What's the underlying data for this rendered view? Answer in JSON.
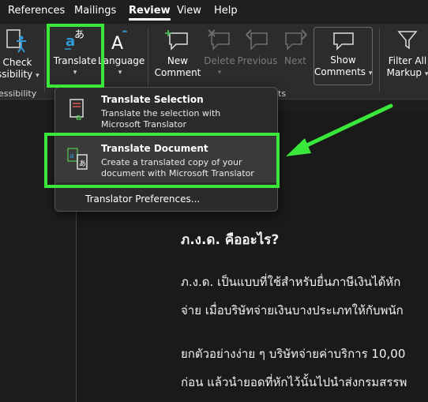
{
  "tabs": [
    "References",
    "Mailings",
    "Review",
    "View",
    "Help"
  ],
  "ribbon": {
    "check_accessibility": {
      "line1": "Check",
      "line2": "ssibility"
    },
    "accessibility_group": "essibility",
    "translate": "Translate",
    "language": "Language",
    "new_comment": {
      "line1": "New",
      "line2": "Comment"
    },
    "delete": "Delete",
    "previous": "Previous",
    "next": "Next",
    "show_comments": {
      "line1": "Show",
      "line2": "Comments"
    },
    "filter_all": {
      "line1": "Filter All",
      "line2": "Markup"
    },
    "comments_group_tail": "ts"
  },
  "menu": {
    "translate_selection": {
      "title": "Translate Selection",
      "desc1": "Translate the selection with",
      "desc2": "Microsoft Translator"
    },
    "translate_document": {
      "title": "Translate Document",
      "desc1": "Create a translated copy of your",
      "desc2": "document with Microsoft Translator"
    },
    "preferences": "Translator Preferences..."
  },
  "document": {
    "heading": "ภ.ง.ด. คืออะไร?",
    "para1_line1": "ภ.ง.ด. เป็นแบบที่ใช้สำหรับยื่นภาษีเงินได้หัก",
    "para1_line2": "จ่าย เมื่อบริษัทจ่ายเงินบางประเภทให้กับพนัก",
    "para2_line1": "ยกตัวอย่างง่าย ๆ บริษัทจ่ายค่าบริการ 10,00",
    "para2_line2": "ก่อน แล้วนำยอดที่หักไว้นั้นไปนำส่งกรมสรรพ"
  },
  "colors": {
    "highlight": "#39e83a",
    "accent_translate": "#2f9bd9",
    "accent_doc": "#4caf50"
  }
}
